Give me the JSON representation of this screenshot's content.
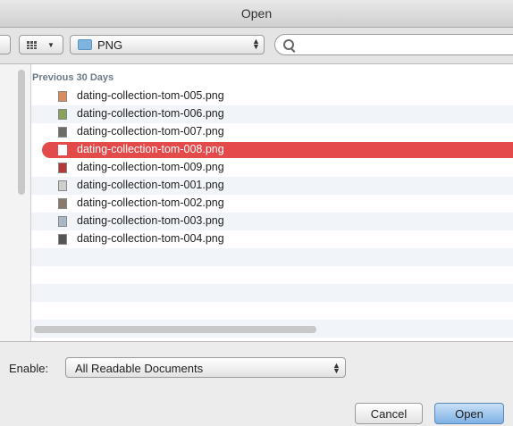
{
  "window": {
    "title": "Open"
  },
  "toolbar": {
    "folder": "PNG",
    "search_placeholder": ""
  },
  "browser": {
    "section": "Previous 30 Days",
    "files": [
      {
        "name": "dating-collection-tom-005.png",
        "color": "#d98c5f"
      },
      {
        "name": "dating-collection-tom-006.png",
        "color": "#8aa15a"
      },
      {
        "name": "dating-collection-tom-007.png",
        "color": "#6e6a66"
      },
      {
        "name": "dating-collection-tom-008.png",
        "color": "#ffffff"
      },
      {
        "name": "dating-collection-tom-009.png",
        "color": "#b43a3a"
      },
      {
        "name": "dating-collection-tom-001.png",
        "color": "#cfcfcf"
      },
      {
        "name": "dating-collection-tom-002.png",
        "color": "#8a7a6a"
      },
      {
        "name": "dating-collection-tom-003.png",
        "color": "#a9b7c6"
      },
      {
        "name": "dating-collection-tom-004.png",
        "color": "#555555"
      }
    ],
    "selected_index": 3,
    "selection_color": "#e34b4b"
  },
  "footer": {
    "enable_label": "Enable:",
    "enable_value": "All Readable Documents",
    "cancel_label": "Cancel",
    "open_label": "Open"
  }
}
